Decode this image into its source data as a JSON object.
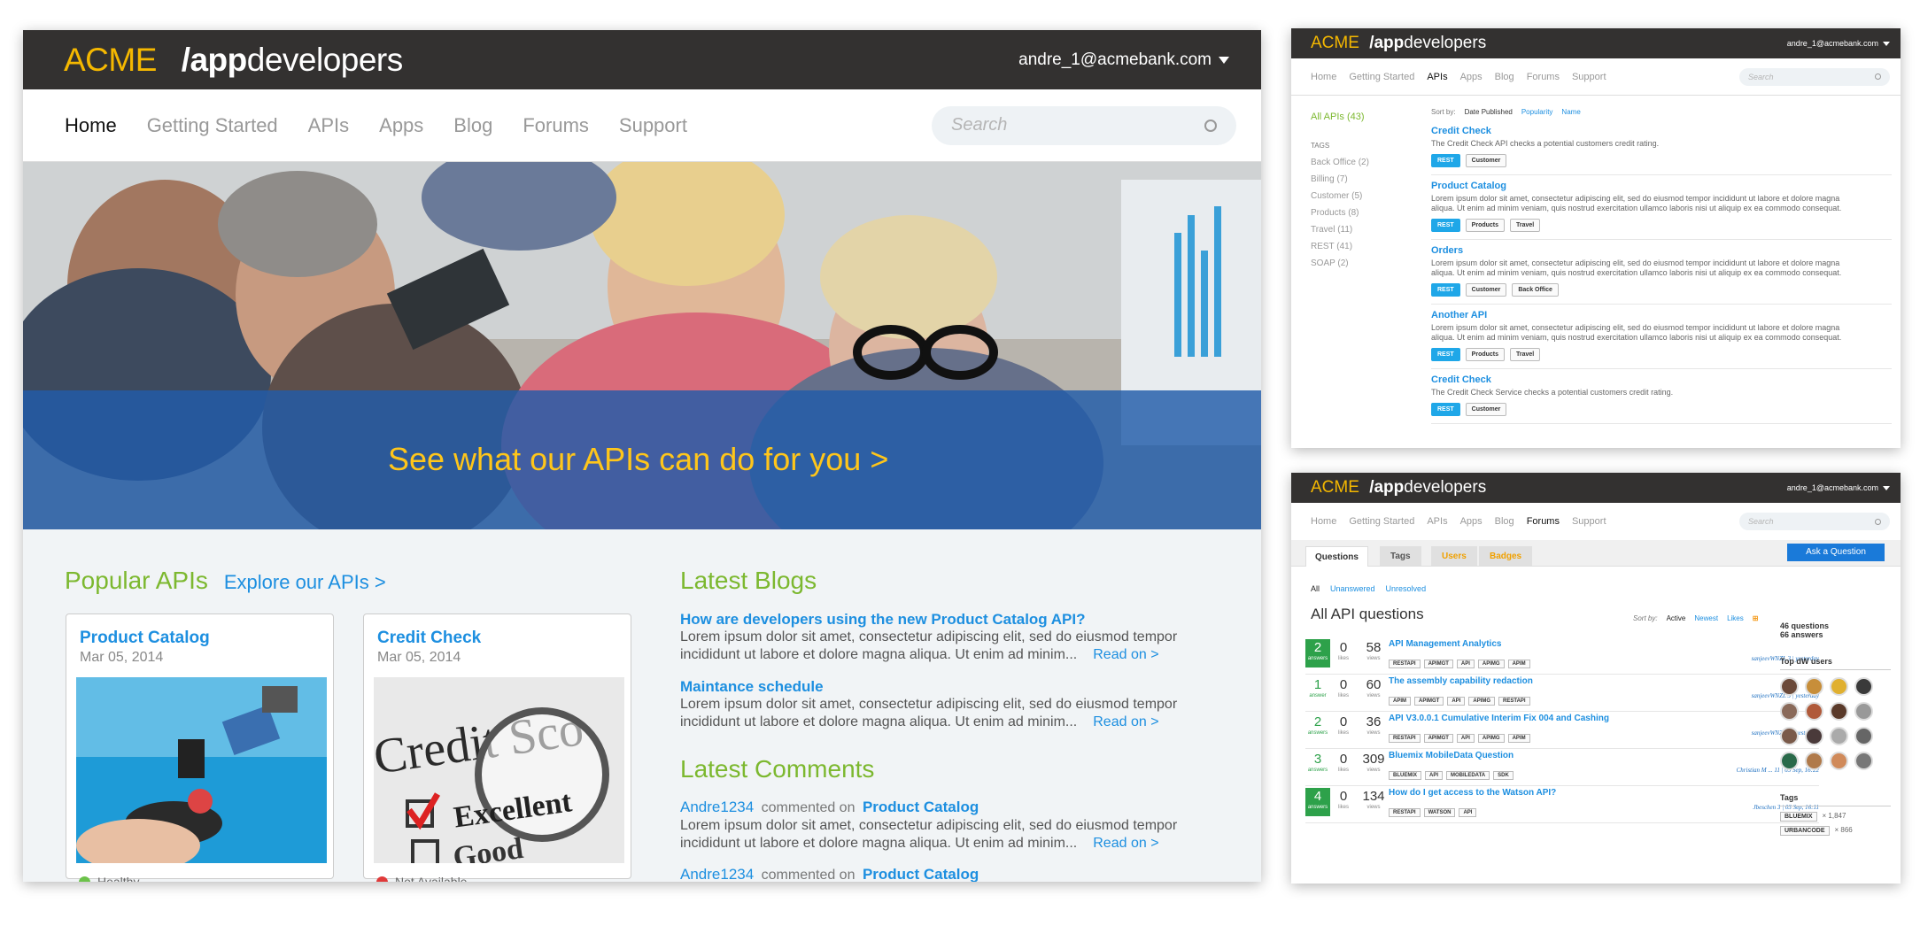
{
  "brand": {
    "acme": "ACME",
    "slash": "/app",
    "dev": "developers"
  },
  "main": {
    "user": "andre_1@acmebank.com",
    "nav": [
      "Home",
      "Getting Started",
      "APIs",
      "Apps",
      "Blog",
      "Forums",
      "Support"
    ],
    "search_placeholder": "Search",
    "hero_text": "See what our APIs can do for you >",
    "popular_title": "Popular APIs",
    "explore_link": "Explore our APIs  >",
    "cards": [
      {
        "title": "Product Catalog",
        "date": "Mar 05, 2014",
        "status": "Healthy",
        "status_color": "#6cc24a"
      },
      {
        "title": "Credit Check",
        "date": "Mar 05, 2014",
        "status": "Not Available",
        "status_color": "#e03a3a"
      }
    ],
    "blogs_title": "Latest Blogs",
    "blogs": [
      {
        "title": "How are developers using the new Product Catalog API?",
        "l1": "Lorem ipsum dolor sit amet, consectetur adipiscing elit, sed do eiusmod tempor",
        "l2": "incididunt ut labore et dolore magna aliqua. Ut enim ad minim...",
        "read": "Read on  >"
      },
      {
        "title": "Maintance schedule",
        "l1": "Lorem ipsum dolor sit amet, consectetur adipiscing elit, sed do eiusmod tempor",
        "l2": "incididunt ut labore et dolore magna aliqua. Ut enim ad minim...",
        "read": "Read on  >"
      }
    ],
    "comments_title": "Latest Comments",
    "comments": [
      {
        "user": "Andre1234",
        "verb": "commented on",
        "target": "Product Catalog",
        "l1": "Lorem ipsum dolor sit amet, consectetur adipiscing elit, sed do eiusmod tempor",
        "l2": "incididunt ut labore et dolore magna aliqua. Ut enim ad minim...",
        "read": "Read on  >"
      },
      {
        "user": "Andre1234",
        "verb": "commented on",
        "target": "Product Catalog"
      }
    ]
  },
  "apis": {
    "user": "andre_1@acmebank.com",
    "nav": [
      "Home",
      "Getting Started",
      "APIs",
      "Apps",
      "Blog",
      "Forums",
      "Support"
    ],
    "search_placeholder": "Search",
    "all": "All APIs (43)",
    "tags_label": "TAGS",
    "tags": [
      "Back Office (2)",
      "Billing (7)",
      "Customer (5)",
      "Products (8)",
      "Travel (11)",
      "REST (41)",
      "SOAP (2)"
    ],
    "sort_label": "Sort by:",
    "sort": [
      "Date Published",
      "Popularity",
      "Name"
    ],
    "items": [
      {
        "title": "Credit Check",
        "d1": "The Credit Check API checks a potential customers credit rating.",
        "d2": "",
        "chips": [
          "REST",
          "Customer"
        ]
      },
      {
        "title": "Product Catalog",
        "d1": "Lorem ipsum dolor sit amet, consectetur adipiscing elit, sed do eiusmod tempor incididunt ut labore et dolore magna",
        "d2": "aliqua. Ut enim ad minim veniam, quis nostrud exercitation ullamco laboris nisi ut aliquip ex ea commodo consequat.",
        "chips": [
          "REST",
          "Products",
          "Travel"
        ]
      },
      {
        "title": "Orders",
        "d1": "Lorem ipsum dolor sit amet, consectetur adipiscing elit, sed do eiusmod tempor incididunt ut labore et dolore magna",
        "d2": "aliqua. Ut enim ad minim veniam, quis nostrud exercitation ullamco laboris nisi ut aliquip ex ea commodo consequat.",
        "chips": [
          "REST",
          "Customer",
          "Back Office"
        ]
      },
      {
        "title": "Another API",
        "d1": "Lorem ipsum dolor sit amet, consectetur adipiscing elit, sed do eiusmod tempor incididunt ut labore et dolore magna",
        "d2": "aliqua. Ut enim ad minim veniam, quis nostrud exercitation ullamco laboris nisi ut aliquip ex ea commodo consequat.",
        "chips": [
          "REST",
          "Products",
          "Travel"
        ]
      },
      {
        "title": "Credit Check",
        "d1": "The Credit Check Service checks a potential customers credit rating.",
        "d2": "",
        "chips": [
          "REST",
          "Customer"
        ]
      }
    ]
  },
  "forums": {
    "user": "andre_1@acmebank.com",
    "nav": [
      "Home",
      "Getting Started",
      "APIs",
      "Apps",
      "Blog",
      "Forums",
      "Support"
    ],
    "search_placeholder": "Search",
    "tabs": [
      "Questions",
      "Tags",
      "Users",
      "Badges"
    ],
    "ask": "Ask a Question",
    "filters": [
      "All",
      "Unanswered",
      "Unresolved"
    ],
    "heading": "All API questions",
    "sort_label": "Sort by:",
    "sort": [
      "Active",
      "Newest",
      "Likes"
    ],
    "side_count_q": "46 questions",
    "side_count_a": "66 answers",
    "top_users": "Top dW users",
    "tags_title": "Tags",
    "side_tags": [
      {
        "t": "BLUEMIX",
        "c": "× 1,847"
      },
      {
        "t": "URBANCODE",
        "c": "× 866"
      }
    ],
    "questions": [
      {
        "answers": "2",
        "alab": "answers",
        "likes": "0",
        "llab": "likes",
        "views": "58",
        "vlab": "views",
        "title": "API Management Analytics",
        "tags": [
          "RESTAPI",
          "APIMGT",
          "API",
          "APIMG",
          "APIM"
        ],
        "meta": "sanjeevWNZL 3  |  yesterday",
        "solved": true
      },
      {
        "answers": "1",
        "alab": "answer",
        "likes": "0",
        "llab": "likes",
        "views": "60",
        "vlab": "views",
        "title": "The assembly capability redaction",
        "tags": [
          "APIM",
          "APIMGT",
          "API",
          "APIMG",
          "RESTAPI"
        ],
        "meta": "sanjeevWNZL 3  |  yesterday",
        "solved": false
      },
      {
        "answers": "2",
        "alab": "answers",
        "likes": "0",
        "llab": "likes",
        "views": "36",
        "vlab": "views",
        "title": "API V3.0.0.1 Cumulative Interim Fix 004 and Cashing",
        "tags": [
          "RESTAPI",
          "APIMGT",
          "API",
          "APIMG",
          "APIM"
        ],
        "meta": "sanjeevWNZL 3  |  yesterday",
        "solved": false
      },
      {
        "answers": "3",
        "alab": "answers",
        "likes": "0",
        "llab": "likes",
        "views": "309",
        "vlab": "views",
        "title": "Bluemix MobileData Question",
        "tags": [
          "BLUEMIX",
          "API",
          "MOBILEDATA",
          "SDK"
        ],
        "meta": "Christian M ... 11  |  03 Sep, 16:22",
        "solved": false
      },
      {
        "answers": "4",
        "alab": "answers",
        "likes": "0",
        "llab": "likes",
        "views": "134",
        "vlab": "views",
        "title": "How do I get access to the Watson API?",
        "tags": [
          "RESTAPI",
          "WATSON",
          "API"
        ],
        "meta": "Jbeschen 3  |  03 Sep, 16:11",
        "solved": true
      }
    ]
  }
}
